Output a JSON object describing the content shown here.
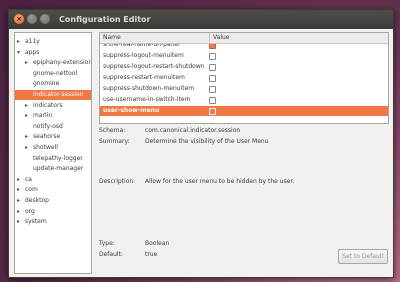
{
  "window": {
    "title": "Configuration Editor"
  },
  "titlebar_buttons": {
    "close_symbol": "×"
  },
  "tree": {
    "items": [
      {
        "label": "a11y",
        "expander": "▸",
        "indent": 0
      },
      {
        "label": "apps",
        "expander": "▾",
        "indent": 0
      },
      {
        "label": "epiphany-extensions",
        "expander": "▸",
        "indent": 1
      },
      {
        "label": "gnome-nettool",
        "expander": "",
        "indent": 1
      },
      {
        "label": "gnomine",
        "expander": "",
        "indent": 1
      },
      {
        "label": "indicator-session",
        "expander": "",
        "indent": 1,
        "selected": true
      },
      {
        "label": "indicators",
        "expander": "▸",
        "indent": 1
      },
      {
        "label": "marlin",
        "expander": "▸",
        "indent": 1
      },
      {
        "label": "notify-osd",
        "expander": "",
        "indent": 1
      },
      {
        "label": "seahorse",
        "expander": "▸",
        "indent": 1
      },
      {
        "label": "shotwell",
        "expander": "▸",
        "indent": 1
      },
      {
        "label": "telepathy-logger",
        "expander": "",
        "indent": 1
      },
      {
        "label": "update-manager",
        "expander": "",
        "indent": 1
      },
      {
        "label": "ca",
        "expander": "▸",
        "indent": 0
      },
      {
        "label": "com",
        "expander": "▸",
        "indent": 0
      },
      {
        "label": "desktop",
        "expander": "▸",
        "indent": 0
      },
      {
        "label": "org",
        "expander": "▸",
        "indent": 0
      },
      {
        "label": "system",
        "expander": "▸",
        "indent": 0
      }
    ]
  },
  "key_table": {
    "headers": {
      "name": "Name",
      "value": "Value"
    },
    "rows": [
      {
        "name": "show-real-name-on-panel",
        "checked": true,
        "state": "partial"
      },
      {
        "name": "suppress-logout-menuitem",
        "checked": false,
        "state": ""
      },
      {
        "name": "suppress-logout-restart-shutdown",
        "checked": false,
        "state": ""
      },
      {
        "name": "suppress-restart-menuitem",
        "checked": false,
        "state": ""
      },
      {
        "name": "suppress-shutdown-menuitem",
        "checked": false,
        "state": ""
      },
      {
        "name": "use-username-in-switch-item",
        "checked": false,
        "state": ""
      },
      {
        "name": "user-show-menu",
        "checked": false,
        "state": "selected"
      }
    ]
  },
  "details": {
    "schema_label": "Schema:",
    "schema_value": "com.canonical.indicator.session",
    "summary_label": "Summary:",
    "summary_value": "Determine the visibility of the User Menu",
    "description_label": "Description:",
    "description_value": "Allow for the user menu to be hidden by the user.",
    "type_label": "Type:",
    "type_value": "Boolean",
    "default_label": "Default:",
    "default_value": "true"
  },
  "buttons": {
    "set_default_label": "Set to Default"
  },
  "colors": {
    "selection": "#f07746",
    "titlebar": "#3c3b37",
    "window_bg": "#f2f1f0"
  }
}
